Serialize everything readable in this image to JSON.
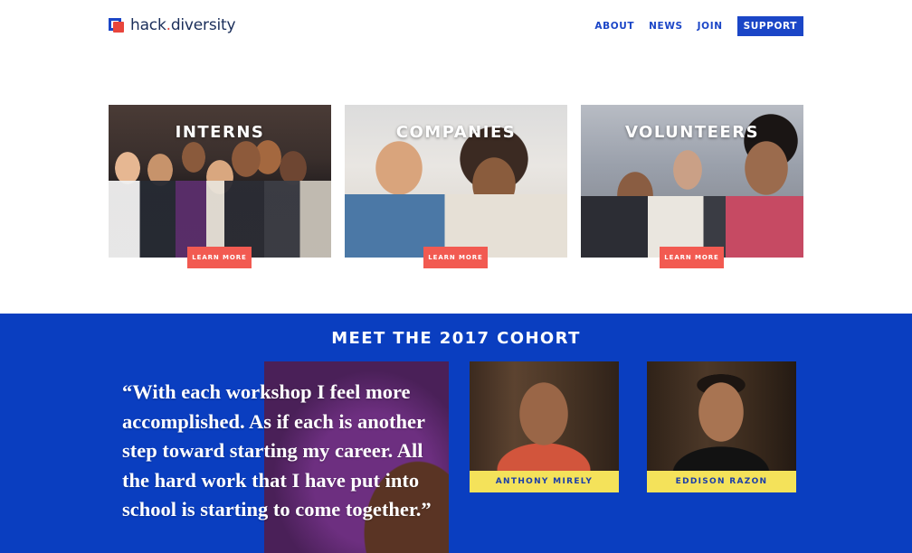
{
  "header": {
    "logo_text_prefix": "hack",
    "logo_text_dot": ".",
    "logo_text_suffix": "diversity",
    "nav": [
      "ABOUT",
      "NEWS",
      "JOIN"
    ],
    "cta": "SUPPORT"
  },
  "cards": [
    {
      "title": "INTERNS",
      "button": "LEARN MORE"
    },
    {
      "title": "COMPANIES",
      "button": "LEARN MORE"
    },
    {
      "title": "VOLUNTEERS",
      "button": "LEARN MORE"
    }
  ],
  "cohort": {
    "title": "MEET THE 2017 COHORT",
    "quote": "“With each workshop I feel more accomplished. As if each is another step toward starting my career. All the hard work that I have put into school is starting to come together.”",
    "people": [
      {
        "name": "ANTHONY MIRELY"
      },
      {
        "name": "EDDISON RAZON"
      }
    ]
  },
  "colors": {
    "brand_blue": "#0a3ec0",
    "nav_blue": "#1b46c7",
    "accent_red": "#f25a51",
    "name_bar_yellow": "#f4e25a"
  }
}
